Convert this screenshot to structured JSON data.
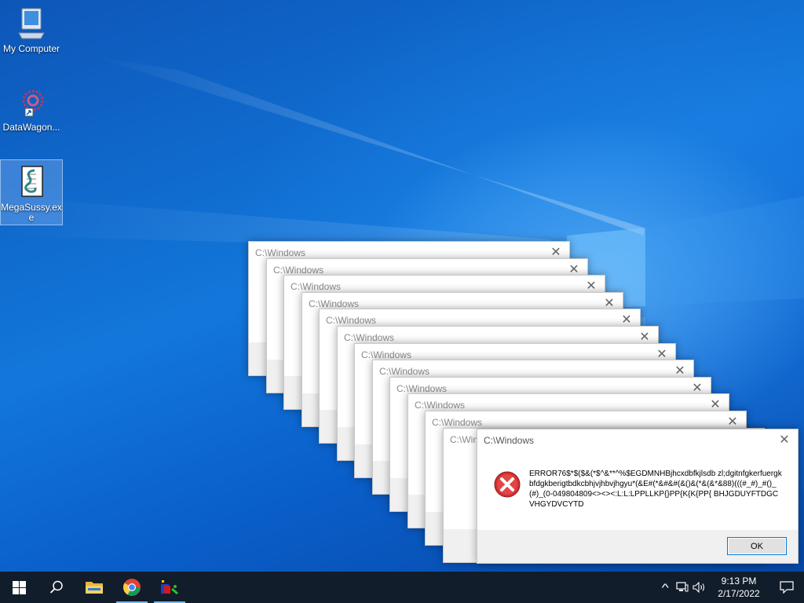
{
  "desktop": {
    "icons": [
      {
        "label": "My Computer",
        "icon": "computer-icon"
      },
      {
        "label": "DataWagon...",
        "icon": "datawagon-icon"
      },
      {
        "label": "MegaSussy.exe",
        "icon": "script-icon"
      }
    ]
  },
  "dialogs": {
    "title": "C:\\Windows",
    "close_glyph": "✕",
    "count": 13,
    "front": {
      "title": "C:\\Windows",
      "message": "ERROR76$*$($&(*$^&**^%$EGDMNHBjhcxdbfkjlsdb zl;dgitnfgkerfuergkbfdgkberigtbdkcbhjvjhbvjhgyu*(&E#(*&#&#(&()&(*&(&*&88)(((#_#)_#()_(#)_(0-049804809<><><:L:L:LPPLLKP{}PP{K{K{PP{ BHJGDUYFTDGCVHGYDVCYTD",
      "ok_label": "OK",
      "icon": "error-icon"
    }
  },
  "taskbar": {
    "start_icon": "windows-start-icon",
    "search_icon": "search-icon",
    "apps": [
      {
        "name": "file-explorer",
        "icon": "folder-icon"
      },
      {
        "name": "chrome",
        "icon": "chrome-icon"
      },
      {
        "name": "megasussy-app",
        "icon": "app-icon"
      }
    ],
    "tray": {
      "chevron_glyph": "^",
      "network_icon": "network-icon",
      "volume_icon": "volume-icon",
      "time": "9:13 PM",
      "date": "2/17/2022",
      "notification_icon": "notification-icon"
    }
  }
}
